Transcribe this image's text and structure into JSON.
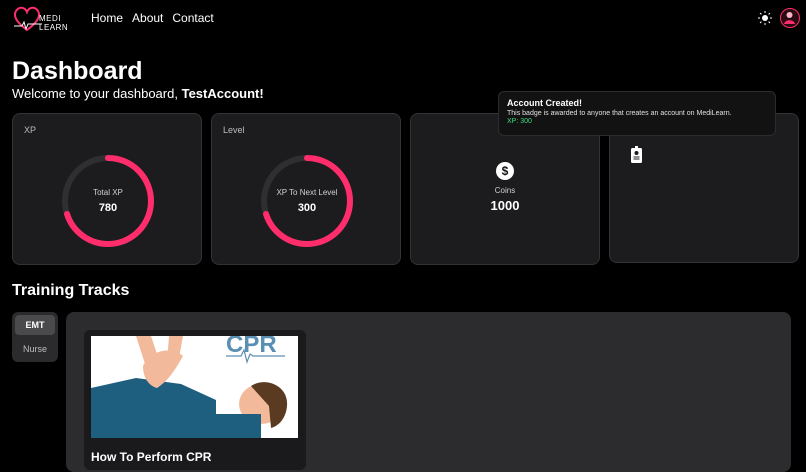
{
  "brand": {
    "name": "MEDI LEARN",
    "accent": "#ff2d6b"
  },
  "nav": {
    "links": [
      "Home",
      "About",
      "Contact"
    ],
    "theme_icon": "sun-icon",
    "avatar_icon": "user-avatar-icon"
  },
  "header": {
    "title": "Dashboard",
    "welcome_prefix": "Welcome to your dashboard,",
    "username": "TestAccount!"
  },
  "cards": {
    "xp": {
      "label": "XP",
      "caption": "Total XP",
      "value": "780",
      "progress": 0.7
    },
    "level": {
      "label": "Level",
      "caption": "XP To Next Level",
      "value": "300",
      "progress": 0.7
    },
    "coins": {
      "caption": "Coins",
      "value": "1000",
      "icon": "dollar-coin-icon"
    },
    "badges": {
      "icon": "id-badge-icon"
    }
  },
  "tooltip": {
    "title": "Account Created!",
    "description": "This badge is awarded to anyone that creates an account on MediLearn.",
    "xp": "XP: 300"
  },
  "training": {
    "title": "Training Tracks",
    "tracks": [
      "EMT",
      "Nurse"
    ],
    "active_track": "EMT",
    "courses": [
      {
        "title": "How To Perform CPR",
        "image_text": "CPR"
      }
    ]
  }
}
